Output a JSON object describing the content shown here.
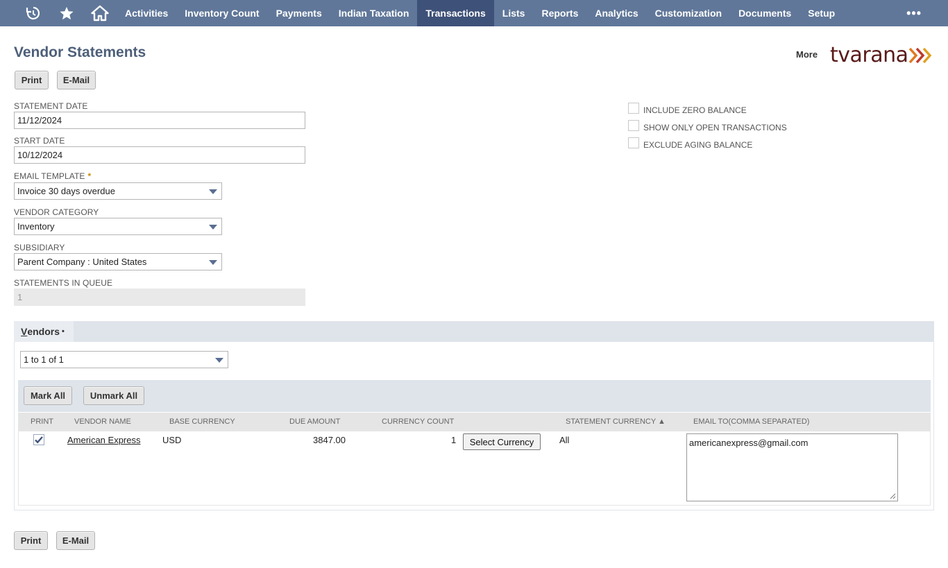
{
  "nav": {
    "icons": [
      "recent-icon",
      "star-icon",
      "home-icon"
    ],
    "items": [
      "Activities",
      "Inventory Count",
      "Payments",
      "Indian Taxation",
      "Transactions",
      "Lists",
      "Reports",
      "Analytics",
      "Customization",
      "Documents",
      "Setup"
    ],
    "active": "Transactions",
    "more": "•••"
  },
  "header": {
    "title": "Vendor Statements",
    "more_label": "More",
    "logo_text": "tvarana"
  },
  "buttons": {
    "print": "Print",
    "email": "E-Mail",
    "mark_all": "Mark All",
    "unmark_all": "Unmark All",
    "select_currency": "Select Currency"
  },
  "fields": {
    "statement_date": {
      "label": "STATEMENT DATE",
      "value": "11/12/2024"
    },
    "start_date": {
      "label": "START DATE",
      "value": "10/12/2024"
    },
    "email_template": {
      "label": "EMAIL TEMPLATE",
      "required_mark": "*",
      "value": "Invoice 30 days overdue"
    },
    "vendor_category": {
      "label": "VENDOR CATEGORY",
      "value": "Inventory"
    },
    "subsidiary": {
      "label": "SUBSIDIARY",
      "value": "Parent Company : United States"
    },
    "statements_in_queue": {
      "label": "STATEMENTS IN QUEUE",
      "value": "1"
    }
  },
  "options": {
    "include_zero_balance": {
      "label": "INCLUDE ZERO BALANCE",
      "checked": false
    },
    "show_only_open": {
      "label": "SHOW ONLY OPEN TRANSACTIONS",
      "checked": false
    },
    "exclude_aging": {
      "label": "EXCLUDE AGING BALANCE",
      "checked": false
    }
  },
  "vendors_tab": {
    "label_first": "V",
    "label_rest": "endors",
    "dot": "•",
    "pager": "1 to 1 of 1",
    "columns": {
      "print": "PRINT",
      "vendor_name": "VENDOR NAME",
      "base_currency": "BASE CURRENCY",
      "due_amount": "DUE AMOUNT",
      "currency_count": "CURRENCY COUNT",
      "statement_currency": "STATEMENT CURRENCY ▲",
      "email_to": "EMAIL TO(COMMA SEPARATED)"
    },
    "rows": [
      {
        "print": true,
        "vendor_name": "American Express",
        "base_currency": "USD",
        "due_amount": "3847.00",
        "currency_count": "1",
        "statement_currency": "All",
        "email_to": "americanexpress@gmail.com"
      }
    ]
  },
  "colors": {
    "nav_bg": "#607799",
    "nav_active": "#3e5178",
    "title": "#4d5f79",
    "tab_bg": "#dfe4eb"
  }
}
